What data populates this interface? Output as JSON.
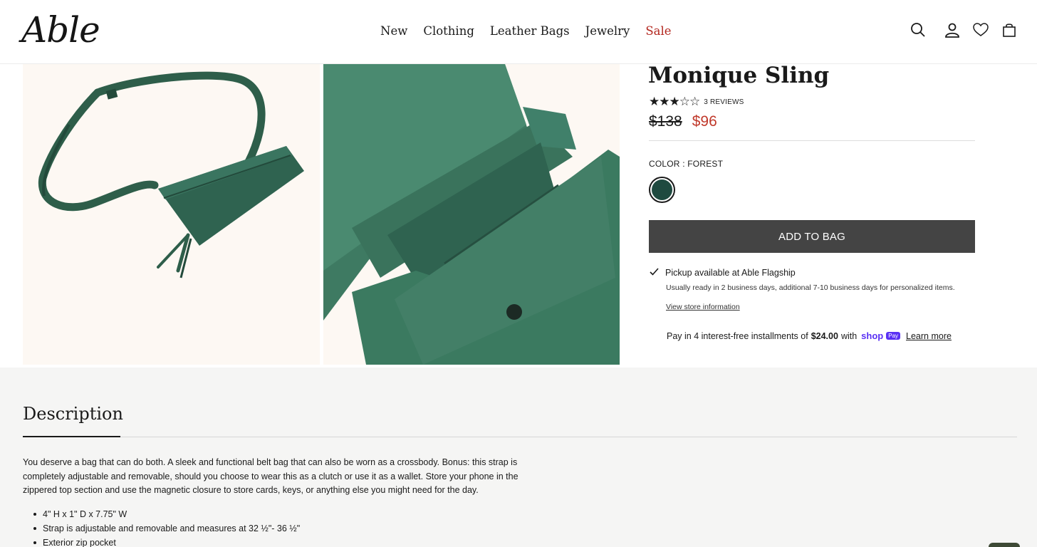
{
  "brand": {
    "logo_text": "Able"
  },
  "nav": {
    "items": [
      "New",
      "Clothing",
      "Leather Bags",
      "Jewelry",
      "Sale"
    ],
    "sale_color": "#b3261e"
  },
  "header_icons": [
    "search-icon",
    "account-icon",
    "wishlist-heart-icon",
    "shopping-bag-icon"
  ],
  "product": {
    "title": "Monique Sling",
    "rating": 3,
    "rating_max": 5,
    "stars_text": "★★★☆☆",
    "reviews_label": "3 REVIEWS",
    "original_price": "$138",
    "sale_price": "$96",
    "color_label": "COLOR : FOREST",
    "swatch_color": "#1f4a40",
    "add_to_bag": "ADD TO BAG",
    "pickup_prefix": "Pickup available at ",
    "pickup_location": "Able Flagship",
    "pickup_note": "Usually ready in 2 business days, additional 7-10 business days for personalized items.",
    "store_link": "View store information",
    "installments_prefix": "Pay in 4 interest-free installments of",
    "installments_amount": "$24.00",
    "installments_with": "with",
    "shop_text": "shop",
    "pay_text": "Pay",
    "learn_more": "Learn more"
  },
  "description": {
    "tab_label": "Description",
    "text": "You deserve a bag that can do both. A sleek and functional belt bag that can also be worn as a crossbody. Bonus: this strap is completely adjustable and removable, should you choose to wear this as a clutch or use it as a wallet. Store your phone in the zippered top section and use the magnetic closure to store cards, keys, or anything else you might need for the day.",
    "bullets": [
      "4\" H x 1\" D x 7.75\" W",
      "Strap is adjustable and removable and measures at 32 ½\"- 36 ½\"",
      "Exterior zip pocket"
    ]
  },
  "colors": {
    "accent_sale": "#c0392b",
    "button_bg": "#444444",
    "bag_green": "#2e5e4a"
  }
}
